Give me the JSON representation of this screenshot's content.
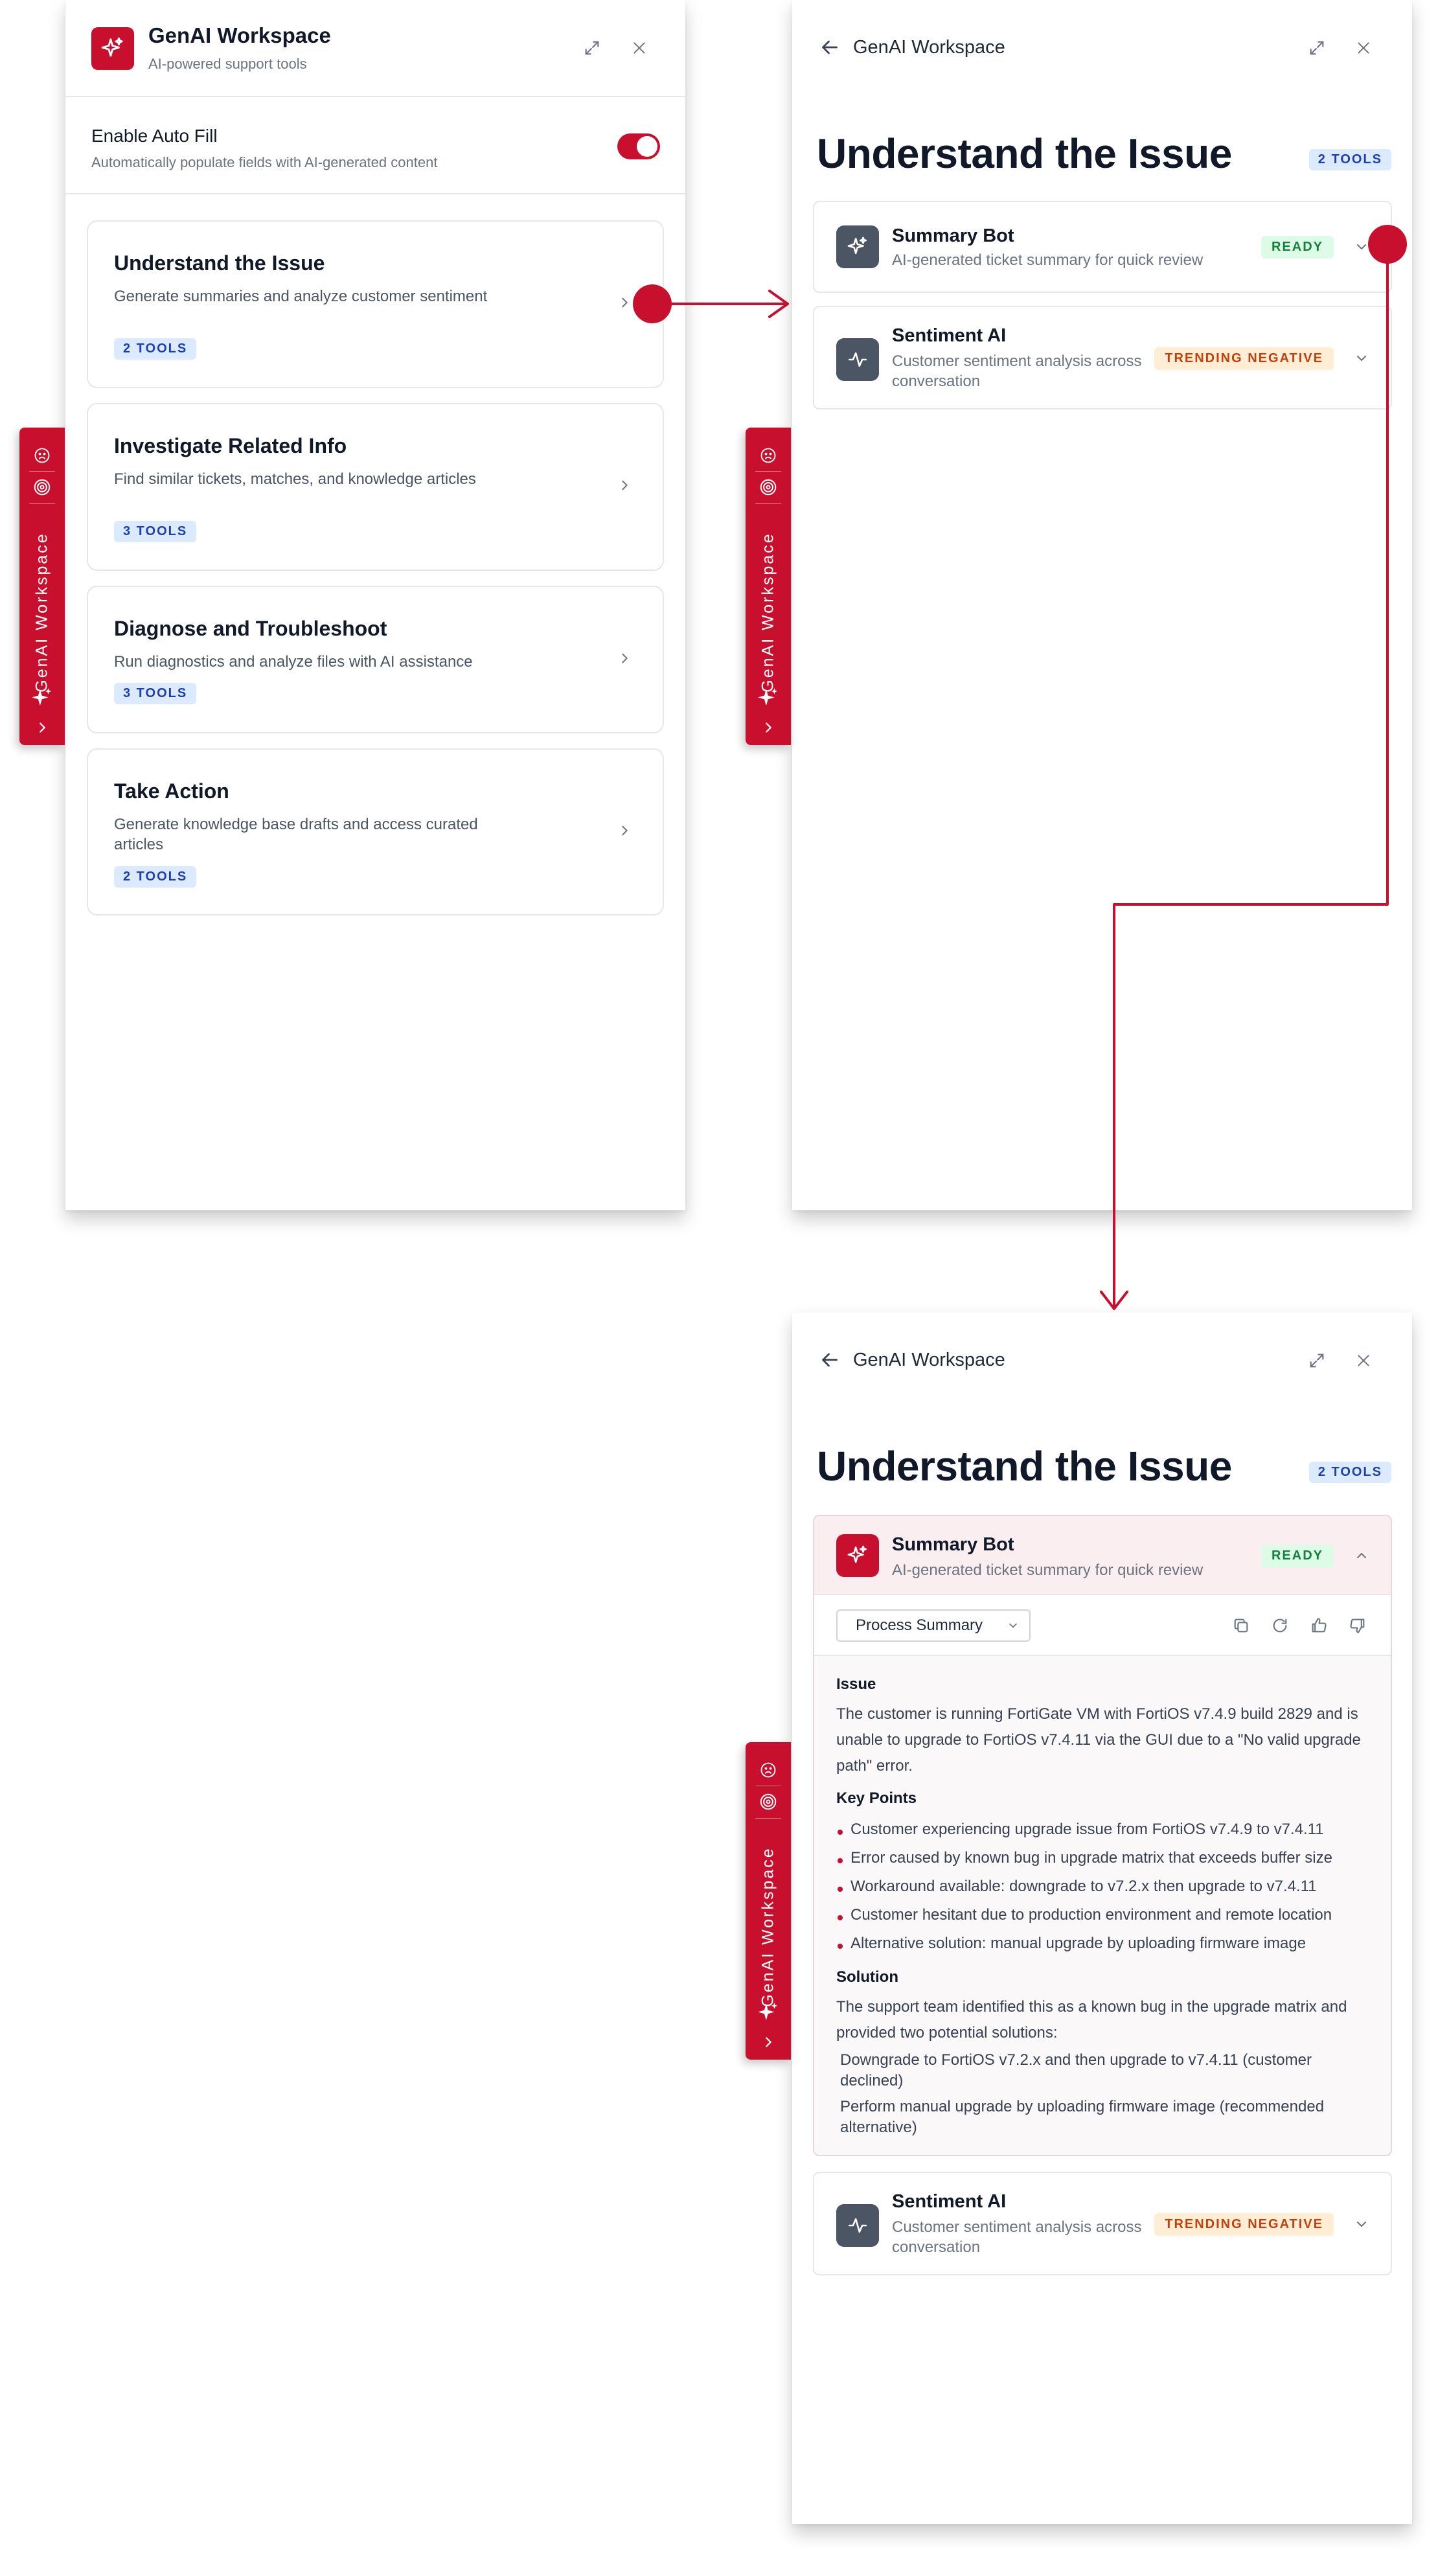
{
  "app": {
    "title": "GenAI Workspace",
    "subtitle": "AI-powered support tools"
  },
  "rail": {
    "label": "GenAI Workspace",
    "icons": [
      "sad-face-icon",
      "target-icon",
      "sparkle-icon",
      "chevron-right-icon"
    ]
  },
  "autofill": {
    "title": "Enable Auto Fill",
    "description": "Automatically populate fields with AI-generated content",
    "enabled": true
  },
  "categories": [
    {
      "title": "Understand the Issue",
      "description": "Generate summaries and analyze customer sentiment",
      "badge": "2 TOOLS"
    },
    {
      "title": "Investigate Related Info",
      "description": "Find similar tickets, matches, and knowledge articles",
      "badge": "3 TOOLS"
    },
    {
      "title": "Diagnose and Troubleshoot",
      "description": "Run diagnostics and analyze files with AI assistance",
      "badge": "3 TOOLS"
    },
    {
      "title": "Take Action",
      "description": "Generate knowledge base drafts and access curated articles",
      "badge": "2 TOOLS"
    }
  ],
  "detail": {
    "back_label": "GenAI Workspace",
    "section_title": "Understand the Issue",
    "section_badge": "2 TOOLS",
    "tools": [
      {
        "name": "Summary Bot",
        "description": "AI-generated ticket summary for quick review",
        "status": "READY",
        "icon": "sparkle-icon"
      },
      {
        "name": "Sentiment AI",
        "description": "Customer sentiment analysis across conversation",
        "status": "TRENDING NEGATIVE",
        "icon": "pulse-icon"
      }
    ]
  },
  "summary": {
    "select_value": "Process Summary",
    "actions": [
      "copy-icon",
      "refresh-icon",
      "thumbs-up-icon",
      "thumbs-down-icon"
    ],
    "issue_heading": "Issue",
    "issue_text": "The customer is running FortiGate VM with FortiOS v7.4.9 build 2829 and is unable to upgrade to FortiOS v7.4.11 via the GUI due to a \"No valid upgrade path\" error.",
    "key_points_heading": "Key Points",
    "key_points": [
      "Customer experiencing upgrade issue from FortiOS v7.4.9 to v7.4.11",
      "Error caused by known bug in upgrade matrix that exceeds buffer size",
      "Workaround available: downgrade to v7.2.x then upgrade to v7.4.11",
      "Customer hesitant due to production environment and remote location",
      "Alternative solution: manual upgrade by uploading firmware image"
    ],
    "solution_heading": "Solution",
    "solution_text": "The support team identified this as a known bug in the upgrade matrix and provided two potential solutions:",
    "solutions": [
      "Downgrade to FortiOS v7.2.x and then upgrade to v7.4.11 (customer declined)",
      "Perform manual upgrade by uploading firmware image (recommended alternative)"
    ]
  },
  "colors": {
    "brand_red": "#c8102e",
    "ready_green": "#15803d",
    "negative_orange": "#c2410c",
    "badge_blue": "#1e40af"
  }
}
